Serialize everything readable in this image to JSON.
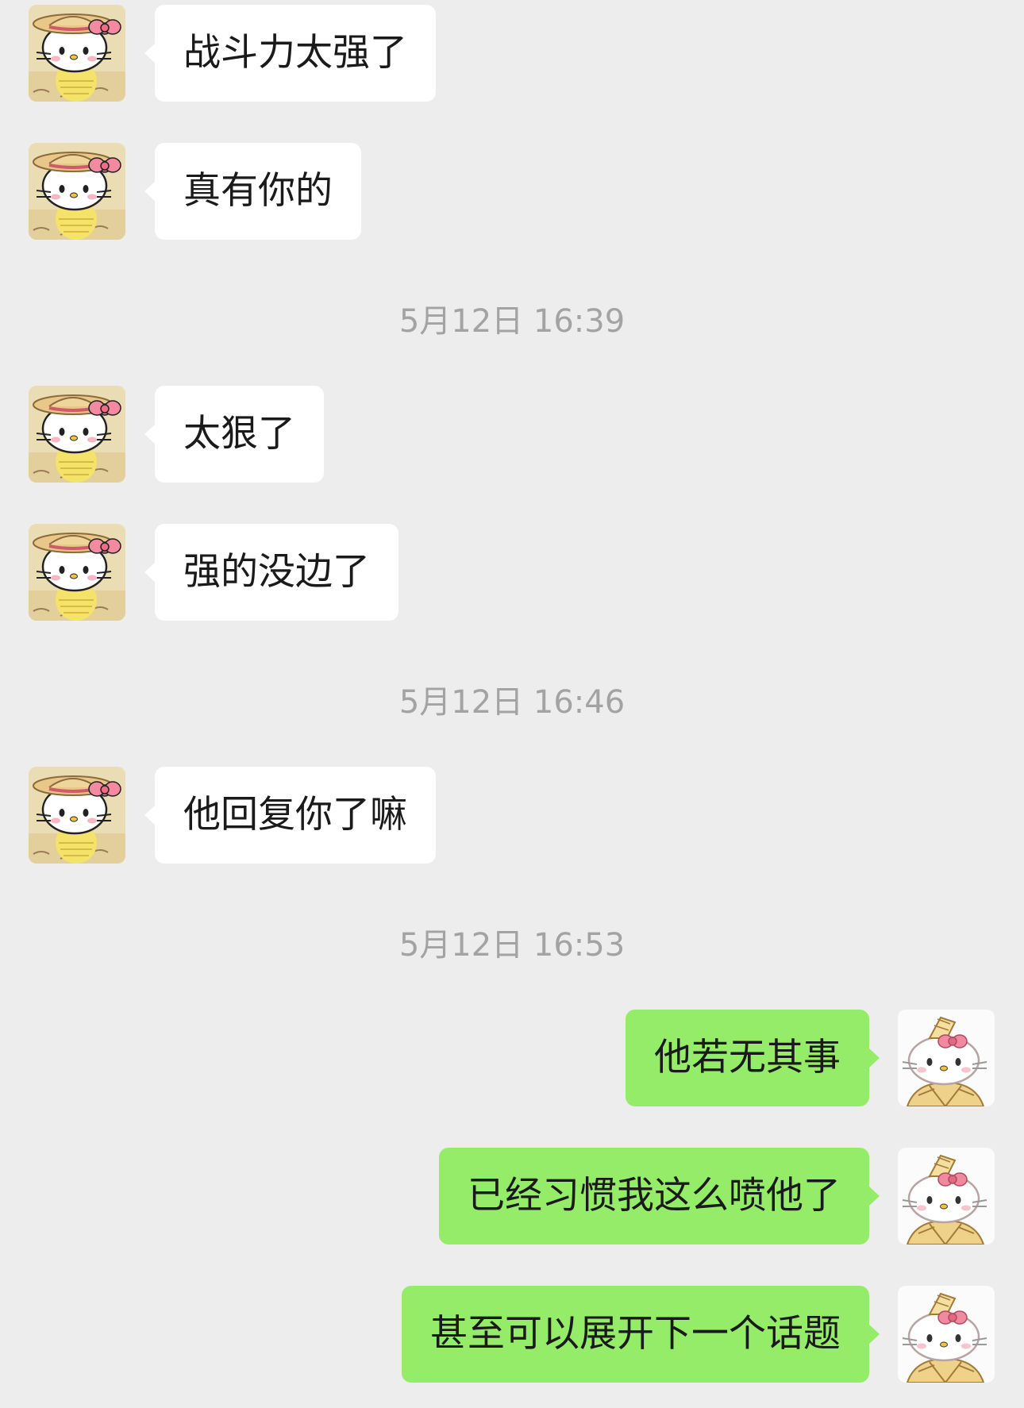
{
  "colors": {
    "background": "#ededed",
    "incoming_bubble": "#ffffff",
    "outgoing_bubble": "#95ec69",
    "timestamp_text": "#a3a3a3"
  },
  "messages": [
    {
      "side": "incoming",
      "avatar": "hello-kitty-straw-hat-avatar",
      "text": "战斗力太强了"
    },
    {
      "side": "incoming",
      "avatar": "hello-kitty-straw-hat-avatar",
      "text": "真有你的"
    },
    {
      "type": "timestamp",
      "text": "5月12日 16:39"
    },
    {
      "side": "incoming",
      "avatar": "hello-kitty-straw-hat-avatar",
      "text": "太狠了"
    },
    {
      "side": "incoming",
      "avatar": "hello-kitty-straw-hat-avatar",
      "text": "强的没边了"
    },
    {
      "type": "timestamp",
      "text": "5月12日 16:46"
    },
    {
      "side": "incoming",
      "avatar": "hello-kitty-straw-hat-avatar",
      "text": "他回复你了嘛"
    },
    {
      "type": "timestamp",
      "text": "5月12日 16:53"
    },
    {
      "side": "outgoing",
      "avatar": "hello-kitty-kimono-avatar",
      "text": "他若无其事"
    },
    {
      "side": "outgoing",
      "avatar": "hello-kitty-kimono-avatar",
      "text": "已经习惯我这么喷他了"
    },
    {
      "side": "outgoing",
      "avatar": "hello-kitty-kimono-avatar",
      "text": "甚至可以展开下一个话题"
    }
  ]
}
